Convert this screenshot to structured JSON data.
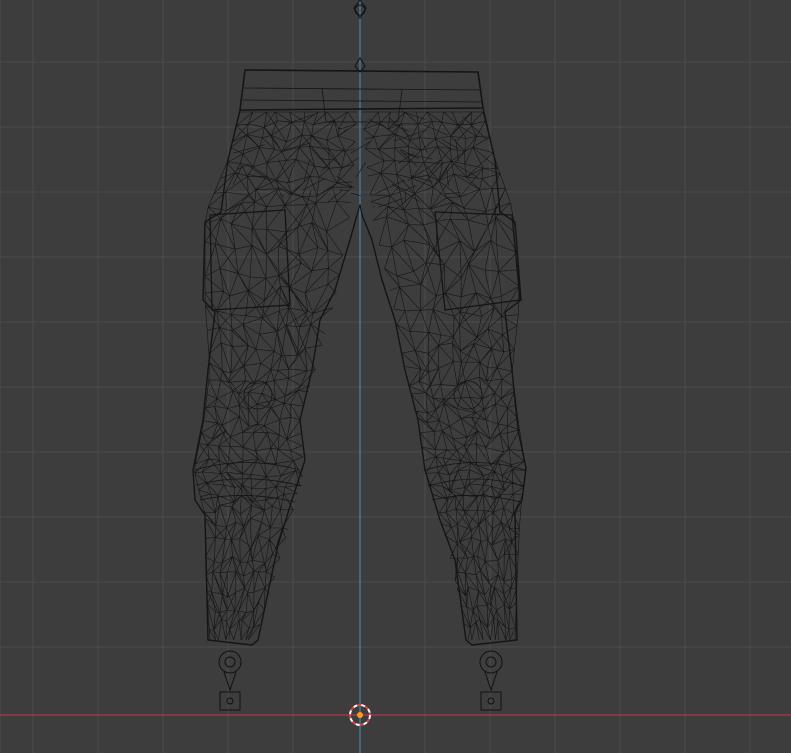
{
  "viewport": {
    "background_color": "#3d3d3d",
    "grid_color": "#4a4a4a",
    "axis_x_color": "#b0394d",
    "axis_z_color": "#4a82b5",
    "wire_color": "#151515",
    "cursor_colors": [
      "#e04040",
      "#ffffff"
    ],
    "origin_color": "#ff9a20"
  },
  "objects": [
    {
      "name": "pants-mesh",
      "display": "wireframe"
    },
    {
      "name": "armature-root-bone"
    },
    {
      "name": "left-foot-bone"
    },
    {
      "name": "right-foot-bone"
    },
    {
      "name": "3d-cursor"
    }
  ]
}
